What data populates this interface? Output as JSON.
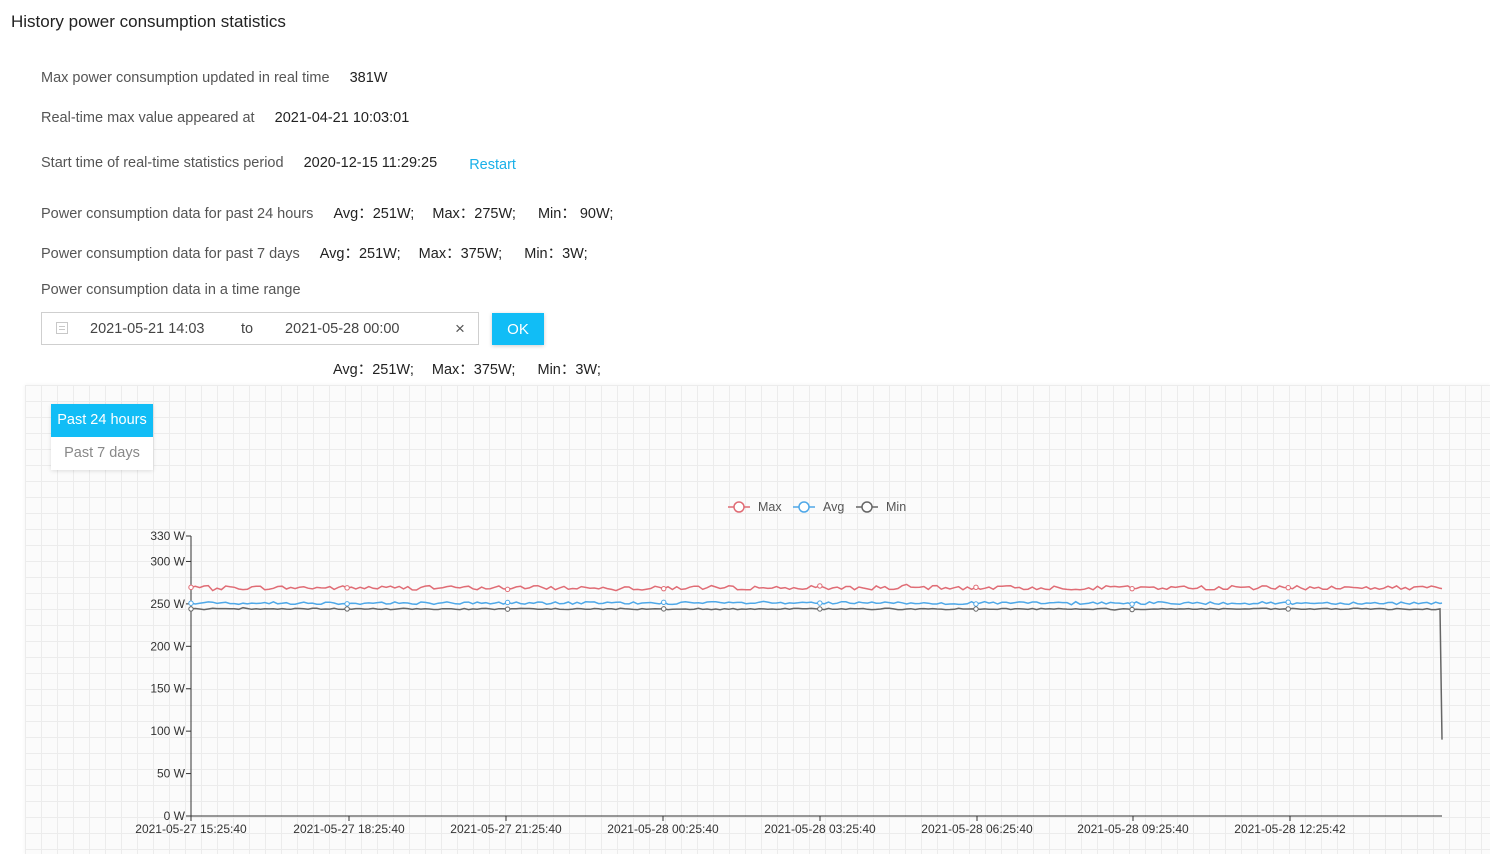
{
  "page": {
    "title": "History power consumption statistics"
  },
  "realtime": {
    "max_label": "Max power consumption updated in real time",
    "max_value": "381W",
    "max_time_label": "Real-time max value appeared at",
    "max_time_value": "2021-04-21 10:03:01",
    "start_label": "Start time of real-time statistics period",
    "start_value": "2020-12-15 11:29:25",
    "restart_label": "Restart"
  },
  "past24h": {
    "label": "Power consumption data for past 24 hours",
    "avg": "Avg：251W;",
    "max": "Max：275W;",
    "min": "Min： 90W;"
  },
  "past7d": {
    "label": "Power consumption data for past 7 days",
    "avg": "Avg：251W;",
    "max": "Max：375W;",
    "min": "Min：3W;"
  },
  "range": {
    "label": "Power consumption data in a time range",
    "start": "2021-05-21 14:03",
    "to": "to",
    "end": "2021-05-28 00:00",
    "clear_icon": "×",
    "ok_label": "OK",
    "avg": "Avg：251W;",
    "max": "Max：375W;",
    "min": "Min：3W;"
  },
  "tabs": [
    {
      "label": "Past 24 hours",
      "active": true
    },
    {
      "label": "Past 7 days",
      "active": false
    }
  ],
  "chart_data": {
    "type": "line",
    "title": "",
    "xlabel": "",
    "ylabel": "",
    "ylim": [
      0,
      330
    ],
    "yticks": [
      "0 W",
      "50 W",
      "100 W",
      "150 W",
      "200 W",
      "250 W",
      "300 W",
      "330 W"
    ],
    "ytick_values": [
      0,
      50,
      100,
      150,
      200,
      250,
      300,
      330
    ],
    "xticks": [
      "2021-05-27 15:25:40",
      "2021-05-27 18:25:40",
      "2021-05-27 21:25:40",
      "2021-05-28 00:25:40",
      "2021-05-28 03:25:40",
      "2021-05-28 06:25:40",
      "2021-05-28 09:25:40",
      "2021-05-28 12:25:42"
    ],
    "x_end": "2021-05-28 15:25:40",
    "grid": false,
    "legend_position": "top-center",
    "series": [
      {
        "name": "Max",
        "color": "#e06c75",
        "baseline": 269,
        "noise": 2.5,
        "last": 268
      },
      {
        "name": "Avg",
        "color": "#4fa8e8",
        "baseline": 251,
        "noise": 1.6,
        "last": 251
      },
      {
        "name": "Min",
        "color": "#666666",
        "baseline": 244,
        "noise": 0.8,
        "last": 90
      }
    ]
  }
}
